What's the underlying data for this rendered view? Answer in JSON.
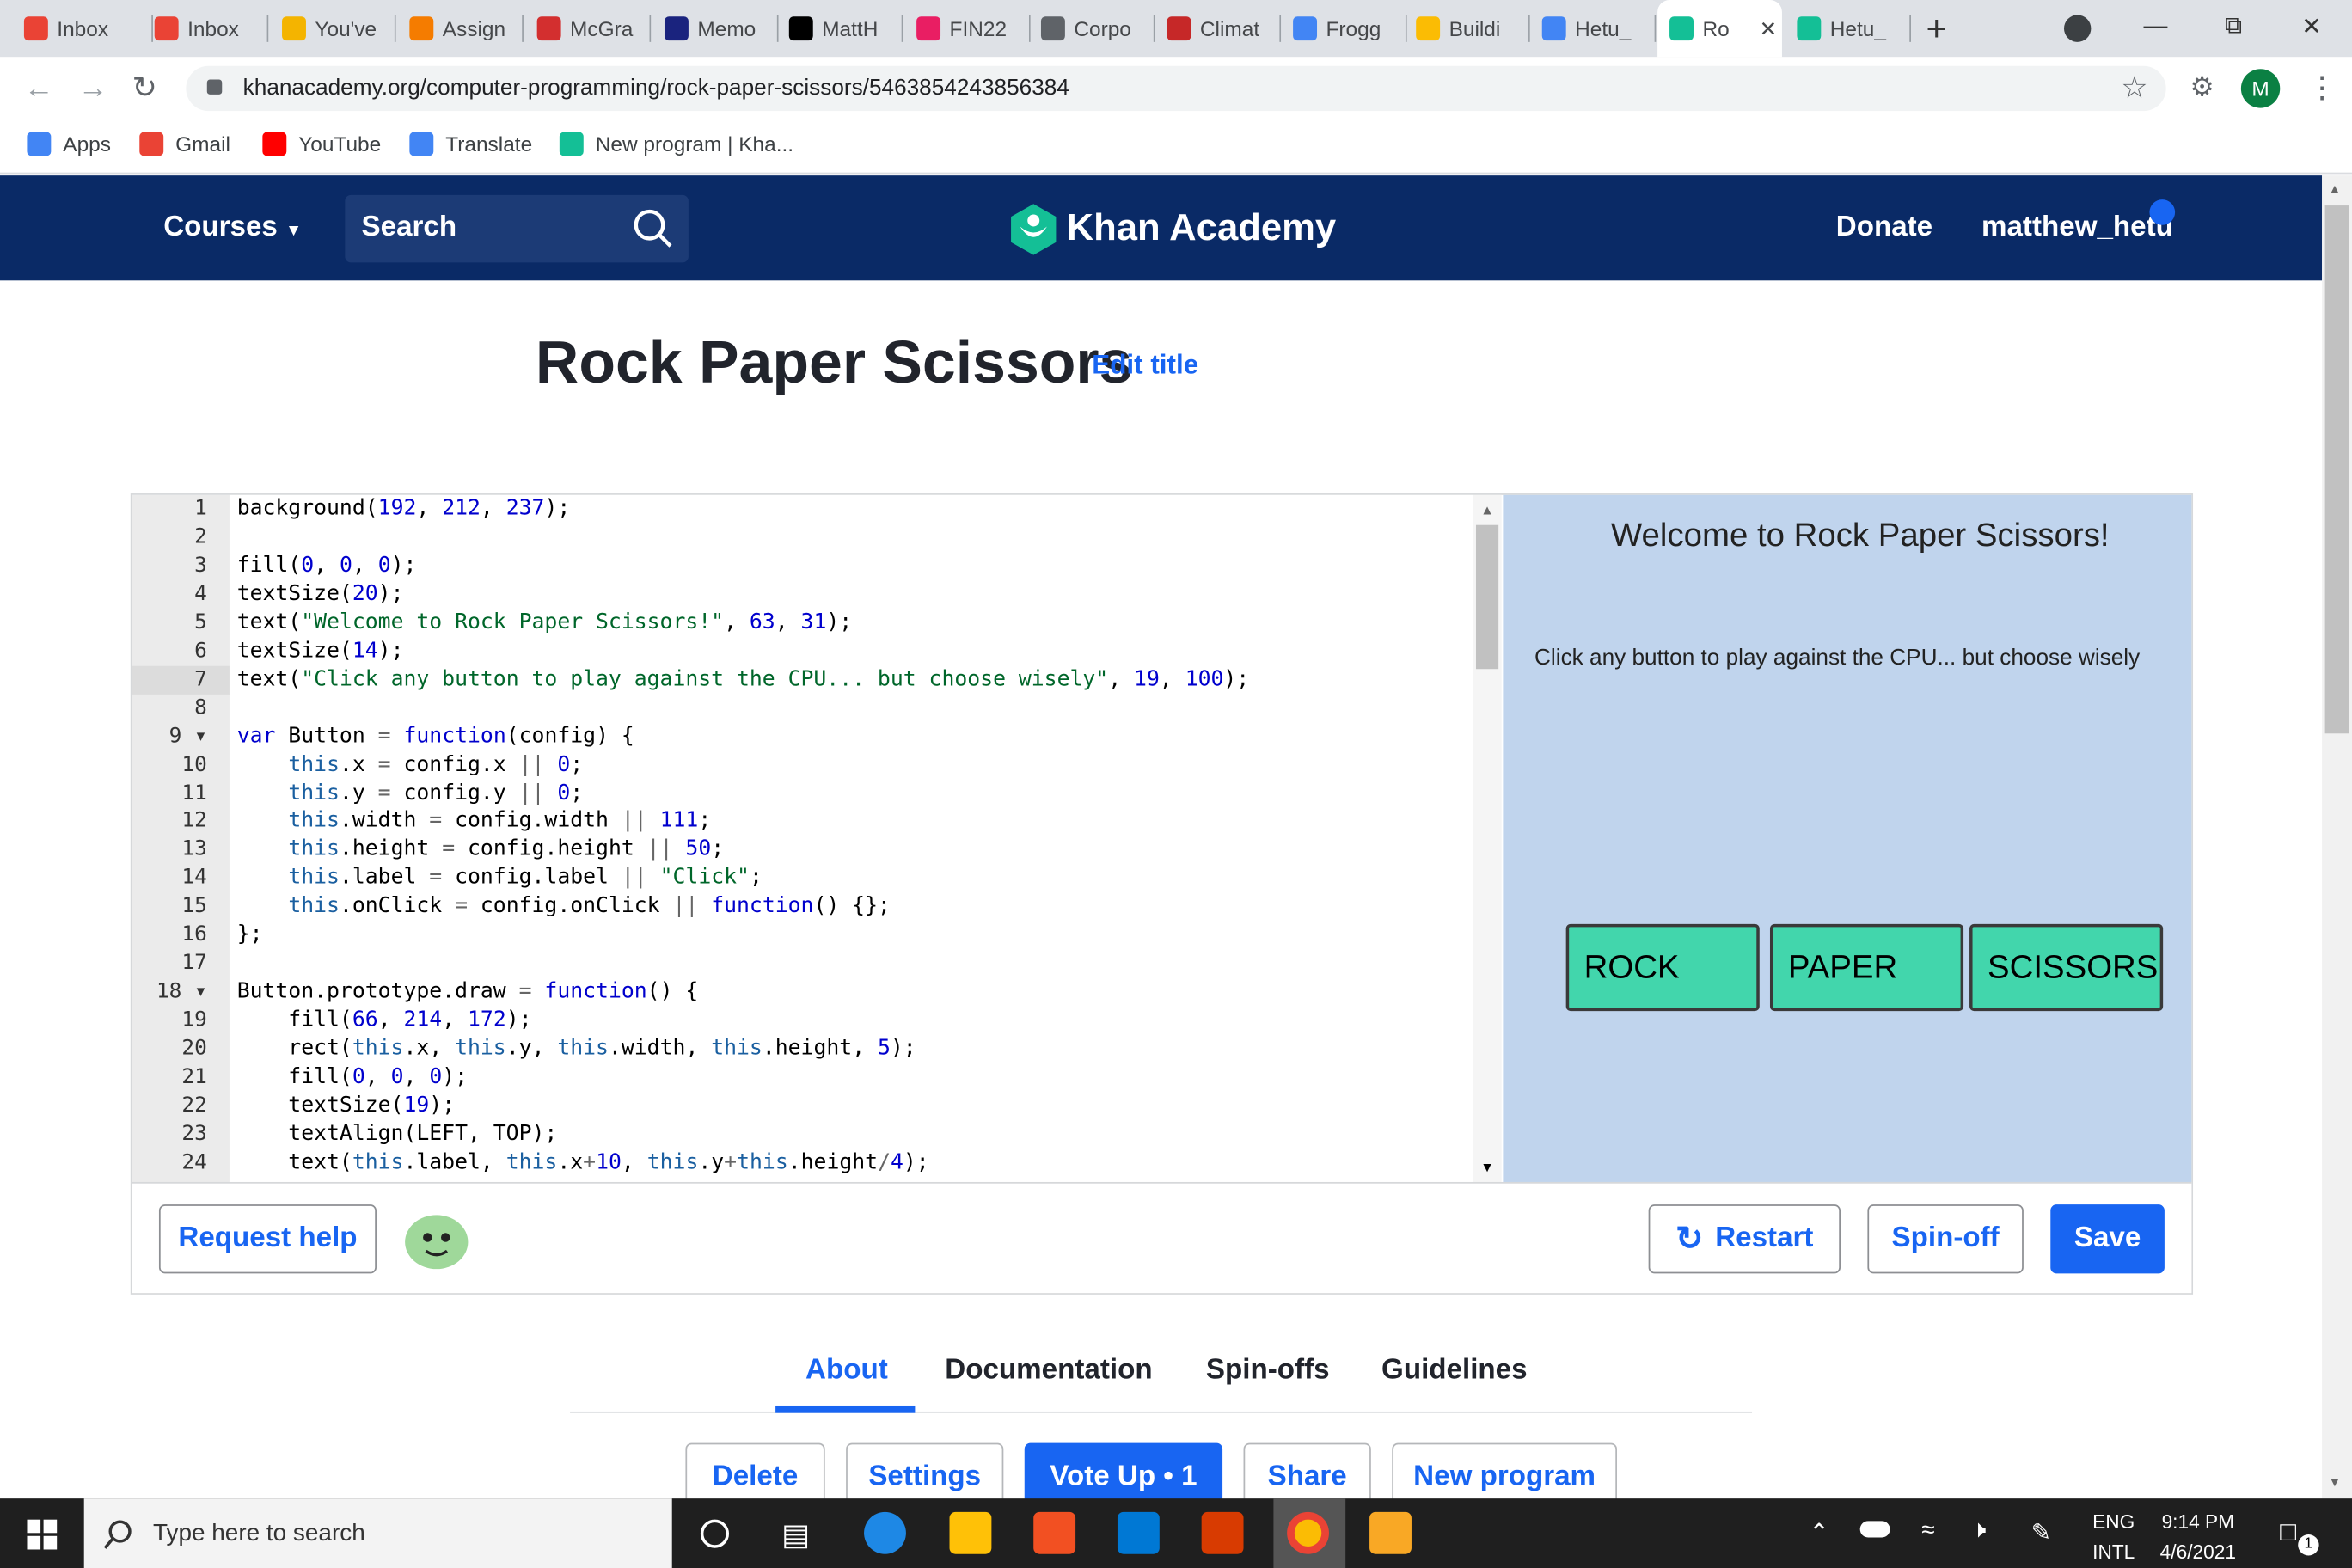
{
  "browser": {
    "tabs": [
      {
        "label": "Inbox",
        "icon": "gmail-icon",
        "color": "#ea4335"
      },
      {
        "label": "Inbox",
        "icon": "gmail-icon",
        "color": "#ea4335"
      },
      {
        "label": "You've",
        "icon": "warning-doc-icon",
        "color": "#f4b400"
      },
      {
        "label": "Assign",
        "icon": "b-icon",
        "color": "#f57c00"
      },
      {
        "label": "McGra",
        "icon": "m-icon",
        "color": "#d32f2f"
      },
      {
        "label": "Memo",
        "icon": "url-cs-icon",
        "color": "#1a237e"
      },
      {
        "label": "MattH",
        "icon": "github-icon",
        "color": "#000000"
      },
      {
        "label": "FIN22",
        "icon": "t-icon",
        "color": "#e91e63"
      },
      {
        "label": "Corpo",
        "icon": "globe-icon",
        "color": "#5f6368"
      },
      {
        "label": "Climat",
        "icon": "enr-icon",
        "color": "#c62828"
      },
      {
        "label": "Frogg",
        "icon": "docs-icon",
        "color": "#4285f4"
      },
      {
        "label": "Buildi",
        "icon": "c-icon",
        "color": "#fbbc04"
      },
      {
        "label": "Hetu_",
        "icon": "docs-icon",
        "color": "#4285f4"
      },
      {
        "label": "Ro",
        "icon": "khan-icon",
        "color": "#14bf96",
        "active": true
      },
      {
        "label": "Hetu_",
        "icon": "khan-icon",
        "color": "#14bf96"
      }
    ],
    "url": "khanacademy.org/computer-programming/rock-paper-scissors/5463854243856384",
    "profile_initial": "M",
    "bookmarks": [
      {
        "label": "Apps",
        "icon": "apps-grid-icon"
      },
      {
        "label": "Gmail",
        "icon": "gmail-icon"
      },
      {
        "label": "YouTube",
        "icon": "youtube-icon"
      },
      {
        "label": "Translate",
        "icon": "translate-icon"
      },
      {
        "label": "New program | Kha...",
        "icon": "khan-icon"
      }
    ]
  },
  "nav": {
    "courses": "Courses",
    "search_placeholder": "Search",
    "logo": "Khan Academy",
    "donate": "Donate",
    "username": "matthew_hetu"
  },
  "program": {
    "title": "Rock Paper Scissors",
    "edit_title": "Edit title"
  },
  "code_lines": [
    "background(192, 212, 237);",
    "",
    "fill(0, 0, 0);",
    "textSize(20);",
    "text(\"Welcome to Rock Paper Scissors!\", 63, 31);",
    "textSize(14);",
    "text(\"Click any button to play against the CPU... but choose wisely\", 19, 100);",
    "",
    "var Button = function(config) {",
    "    this.x = config.x || 0;",
    "    this.y = config.y || 0;",
    "    this.width = config.width || 111;",
    "    this.height = config.height || 50;",
    "    this.label = config.label || \"Click\";",
    "    this.onClick = config.onClick || function() {};",
    "};",
    "",
    "Button.prototype.draw = function() {",
    "    fill(66, 214, 172);",
    "    rect(this.x, this.y, this.width, this.height, 5);",
    "    fill(0, 0, 0);",
    "    textSize(19);",
    "    textAlign(LEFT, TOP);",
    "    text(this.label, this.x+10, this.y+this.height/4);"
  ],
  "canvas": {
    "heading": "Welcome to Rock Paper Scissors!",
    "subtext": "Click any button to play against the CPU... but choose wisely",
    "buttons": [
      "ROCK",
      "PAPER",
      "SCISSORS"
    ],
    "bg_color": "#c0d4ed",
    "button_color": "#42d6ac"
  },
  "editor_actions": {
    "request_help": "Request help",
    "restart": "Restart",
    "spinoff": "Spin-off",
    "save": "Save"
  },
  "page_tabs": [
    "About",
    "Documentation",
    "Spin-offs",
    "Guidelines"
  ],
  "program_actions": {
    "delete": "Delete",
    "settings": "Settings",
    "vote_up": "Vote Up • 1",
    "share": "Share",
    "new_program": "New program"
  },
  "taskbar": {
    "search_placeholder": "Type here to search",
    "lang_top": "ENG",
    "lang_bottom": "INTL",
    "time": "9:14 PM",
    "date": "4/6/2021",
    "notification_count": "1"
  }
}
